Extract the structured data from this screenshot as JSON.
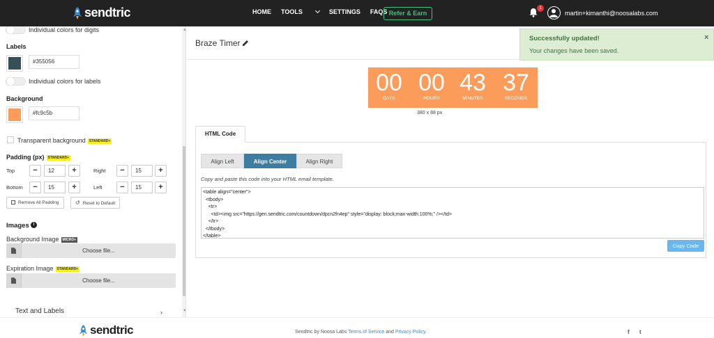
{
  "brand": {
    "name": "sendtric"
  },
  "nav": {
    "items": [
      "HOME",
      "TOOLS",
      "SETTINGS",
      "FAQS"
    ],
    "refer_label": "Refer & Earn",
    "notification_count": "1",
    "user_email": "martin+kimanthi@noosalabs.com"
  },
  "sidebar": {
    "digit_colors_label": "Individual colors for digits",
    "labels_title": "Labels",
    "labels_color": "#355056",
    "label_colors_label": "Individual colors for labels",
    "background_title": "Background",
    "background_color": "#fc9c5b",
    "transparent_label": "Transparent background",
    "standard_badge": "STANDARD+",
    "micro_badge": "MICRO+",
    "padding_title": "Padding (px)",
    "padding": {
      "top_label": "Top",
      "top": "12",
      "right_label": "Right",
      "right": "15",
      "bottom_label": "Bottom",
      "bottom": "15",
      "left_label": "Left",
      "left": "15"
    },
    "remove_padding_label": "Remove All Padding",
    "reset_default_label": "Reset to Default",
    "images_title": "Images",
    "bg_image_label": "Background Image",
    "expiration_image_label": "Expiration Image",
    "choose_file": "Choose file...",
    "next_section": "Text and Labels"
  },
  "main": {
    "title": "Braze Timer",
    "timer": {
      "background": "#fc9c5b",
      "units": [
        {
          "value": "00",
          "label": "DAYS"
        },
        {
          "value": "00",
          "label": "HOURS"
        },
        {
          "value": "43",
          "label": "MINUTES"
        },
        {
          "value": "37",
          "label": "SECONDS"
        }
      ],
      "dimensions": "380 x 88 px"
    },
    "tab": "HTML Code",
    "align_buttons": [
      "Align Left",
      "Align Center",
      "Align Right"
    ],
    "align_active": "Align Center",
    "hint": "Copy and paste this code into your HTML email template.",
    "code": "<table align=\"center\">\n  <tbody>\n    <tr>\n      <td><img src=\"https://gen.sendtric.com/countdown/dpcn2fn4ep\" style=\"display: block;max-width:100%;\" /></td>\n    </tr>\n  </tbody>\n</table>",
    "copy_label": "Copy Code"
  },
  "toast": {
    "title": "Successfully updated!",
    "message": "Your changes have been saved.",
    "close": "×"
  },
  "footer": {
    "by_text": "Sendtric by Noosa Labs",
    "terms": "Terms of Service",
    "and_text": "and",
    "privacy": "Privacy Policy",
    "period": ".",
    "facebook": "f",
    "twitter": "t"
  },
  "colors": {
    "accent_green": "#3cc37c",
    "align_active": "#3f7ca2",
    "copy_button": "#6ab7f0",
    "toast_bg": "#dcedd4"
  }
}
